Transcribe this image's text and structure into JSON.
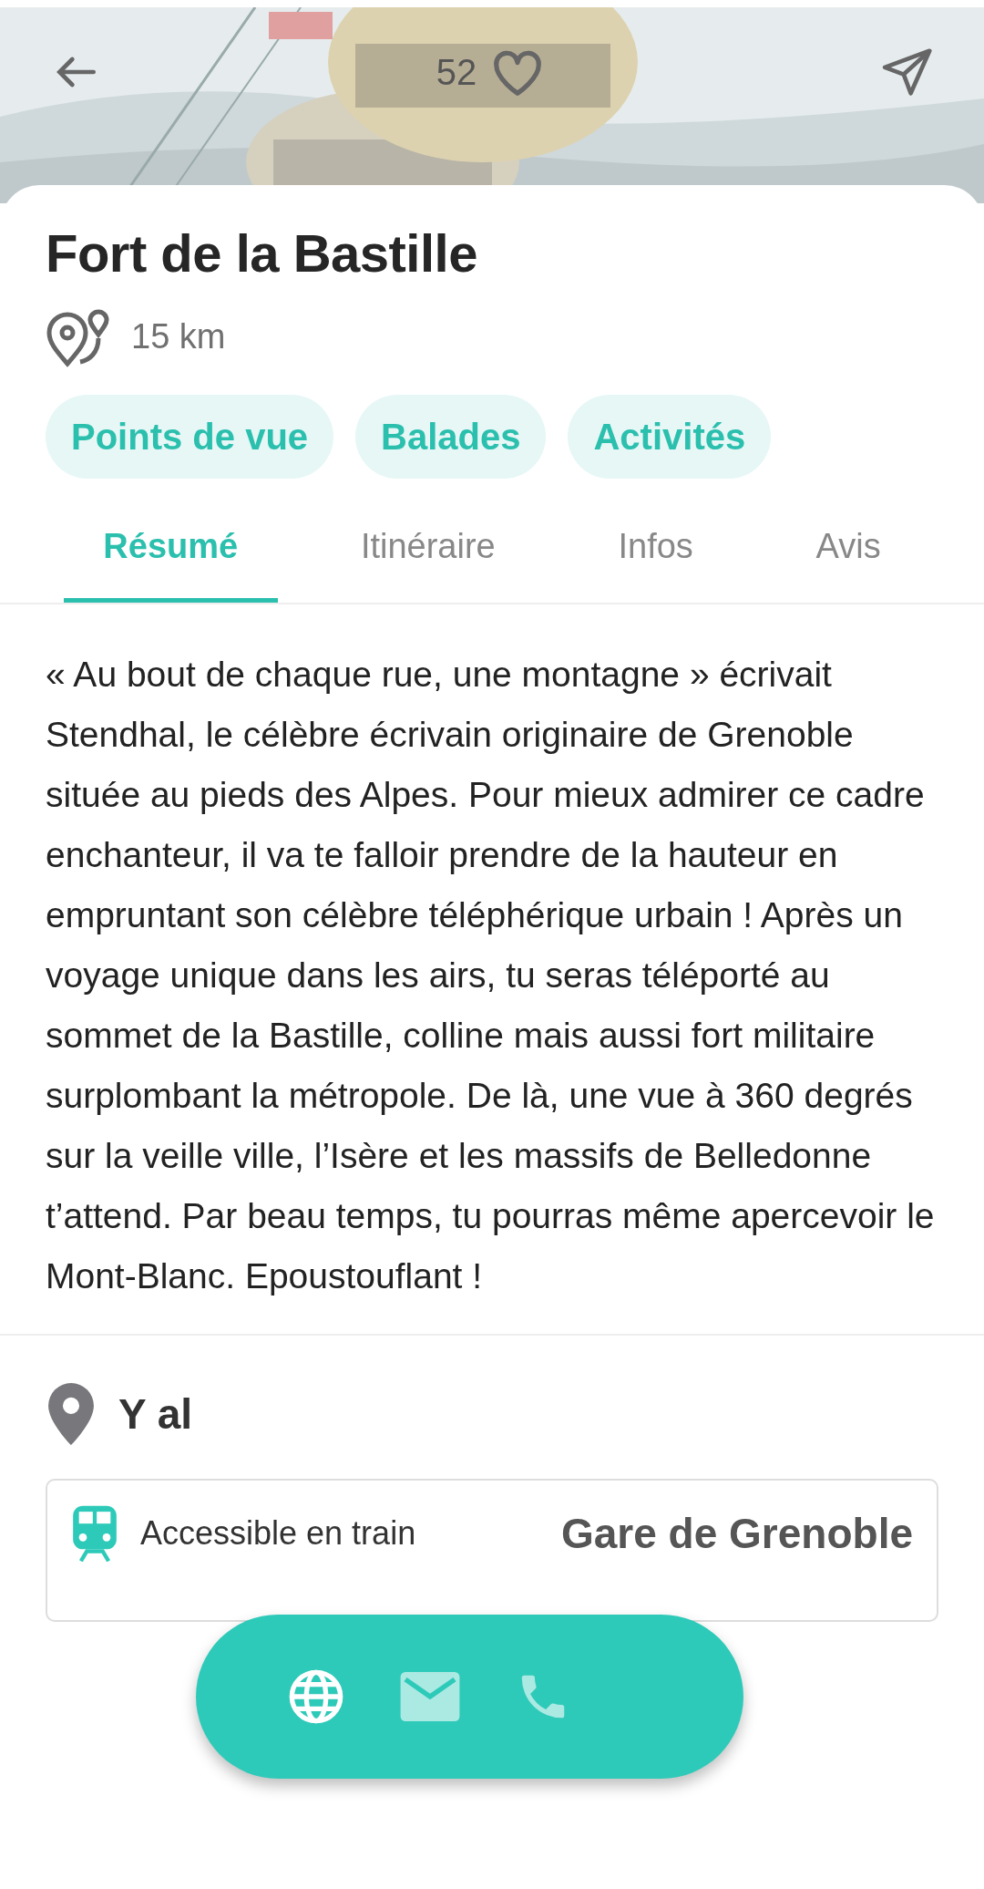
{
  "header": {
    "likes": "52"
  },
  "title": "Fort de la Bastille",
  "distance": "15 km",
  "tags": [
    "Points de vue",
    "Balades",
    "Activités"
  ],
  "tabs": [
    {
      "label": "Résumé",
      "selected": true
    },
    {
      "label": "Itinéraire",
      "selected": false
    },
    {
      "label": "Infos",
      "selected": false
    },
    {
      "label": "Avis",
      "selected": false
    }
  ],
  "description": "« Au bout de chaque rue, une montagne » écrivait Stendhal, le célèbre écrivain originaire de Grenoble située au pieds des Alpes. Pour mieux admirer ce cadre enchanteur, il va te falloir prendre de la hauteur en empruntant son célèbre téléphérique urbain ! Après un voyage unique dans les airs, tu seras téléporté au sommet de la Bastille, colline mais aussi fort militaire surplombant la métropole. De là, une vue à 360 degrés sur la veille ville, l’Isère et les massifs de Belledonne t’attend. Par beau temps, tu pourras même apercevoir le Mont-Blanc. Epoustouflant !",
  "getting_there": {
    "heading": "Y al",
    "access": [
      {
        "label": "Accessible en train",
        "value": "Gare de Grenoble"
      }
    ]
  },
  "contact_actions": [
    {
      "kind": "web",
      "disabled": false
    },
    {
      "kind": "mail",
      "disabled": true
    },
    {
      "kind": "phone",
      "disabled": true
    }
  ]
}
